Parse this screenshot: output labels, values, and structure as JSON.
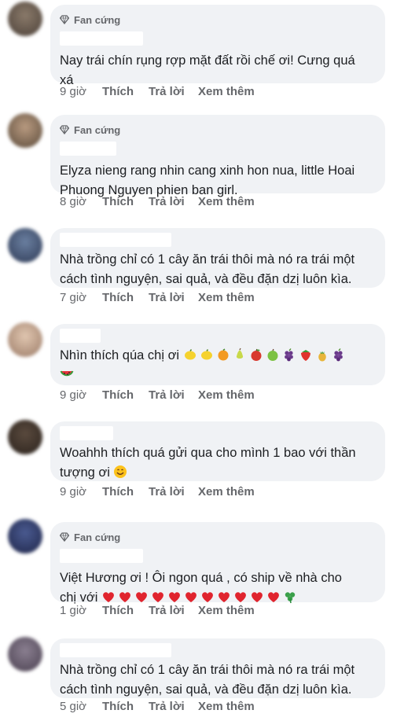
{
  "badge_label": "Fan cứng",
  "actions": {
    "like": "Thích",
    "reply": "Trả lời",
    "more": "Xem thêm"
  },
  "comments": [
    {
      "time": "9 giờ",
      "text": "Nay trái chín rụng rợp mặt đất rồi chế ơi! Cưng quá\nxá"
    },
    {
      "time": "8 giờ",
      "text": "Elyza nieng rang nhin cang xinh hon nua, little Hoai\nPhuong Nguyen phien ban girl."
    },
    {
      "time": "7 giờ",
      "text": "Nhà trồng chỉ có 1 cây ăn trái thôi mà nó ra trái một\ncách tình nguyện, sai quả, và đều đặn dzị luôn kìa."
    },
    {
      "time": "9 giờ",
      "text": "Nhìn thích qúa chị ơi",
      "emoji": [
        "lemon",
        "lemon",
        "orange",
        "pear",
        "apple-red",
        "apple-green",
        "grapes",
        "strawberry",
        "pineapple",
        "grapes"
      ],
      "emoji2": [
        "watermelon"
      ]
    },
    {
      "time": "9 giờ",
      "text": "Woahhh thích quá gửi qua cho mình 1 bao với thần\ntượng ơi",
      "emoji": [
        "smile"
      ]
    },
    {
      "time": "1 giờ",
      "text": "Việt Hương ơi ! Ôi ngon quá , có ship về nhà cho\nchị với",
      "emoji": [
        "heart",
        "heart",
        "heart",
        "heart",
        "heart",
        "heart",
        "heart",
        "heart",
        "heart",
        "heart",
        "heart",
        "shamrock"
      ]
    },
    {
      "time": "5 giờ",
      "text": "Nhà trồng chỉ có 1 cây ăn trái thôi mà nó ra trái một\ncách tình nguyện, sai quả, và đều đặn dzị luôn kìa."
    }
  ],
  "colors": {
    "bubble": "#f0f2f5",
    "meta": "#65676b",
    "text": "#1c1e21"
  }
}
